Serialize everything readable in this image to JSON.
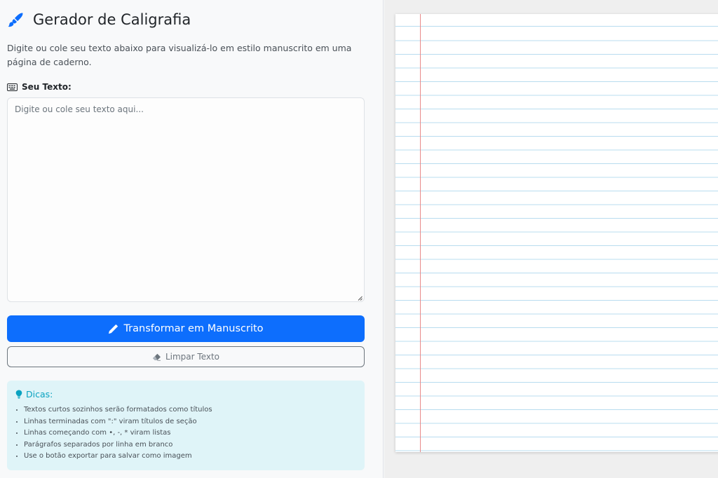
{
  "app": {
    "title": "Gerador de Caligrafia",
    "description": "Digite ou cole seu texto abaixo para visualizá-lo em estilo manuscrito em uma página de caderno."
  },
  "input": {
    "label": "Seu Texto:",
    "placeholder": "Digite ou cole seu texto aqui...",
    "value": ""
  },
  "actions": {
    "transform_label": "Transformar em Manuscrito",
    "clear_label": "Limpar Texto"
  },
  "tips": {
    "heading": "Dicas:",
    "items": [
      "Textos curtos sozinhos serão formatados como títulos",
      "Linhas terminadas com \":\" viram títulos de seção",
      "Linhas começando com •, -, * viram listas",
      "Parágrafos separados por linha em branco",
      "Use o botão exportar para salvar como imagem"
    ]
  },
  "icons": {
    "title": "pen-nib-icon",
    "label": "keyboard-icon",
    "transform": "pencil-icon",
    "clear": "eraser-icon",
    "tips": "lightbulb-icon"
  },
  "colors": {
    "primary": "#0d6efd",
    "info": "#0aa2c0",
    "info_bg": "#dff4f8",
    "paper_rule": "#b8dcef",
    "paper_margin": "#e88a8a"
  }
}
